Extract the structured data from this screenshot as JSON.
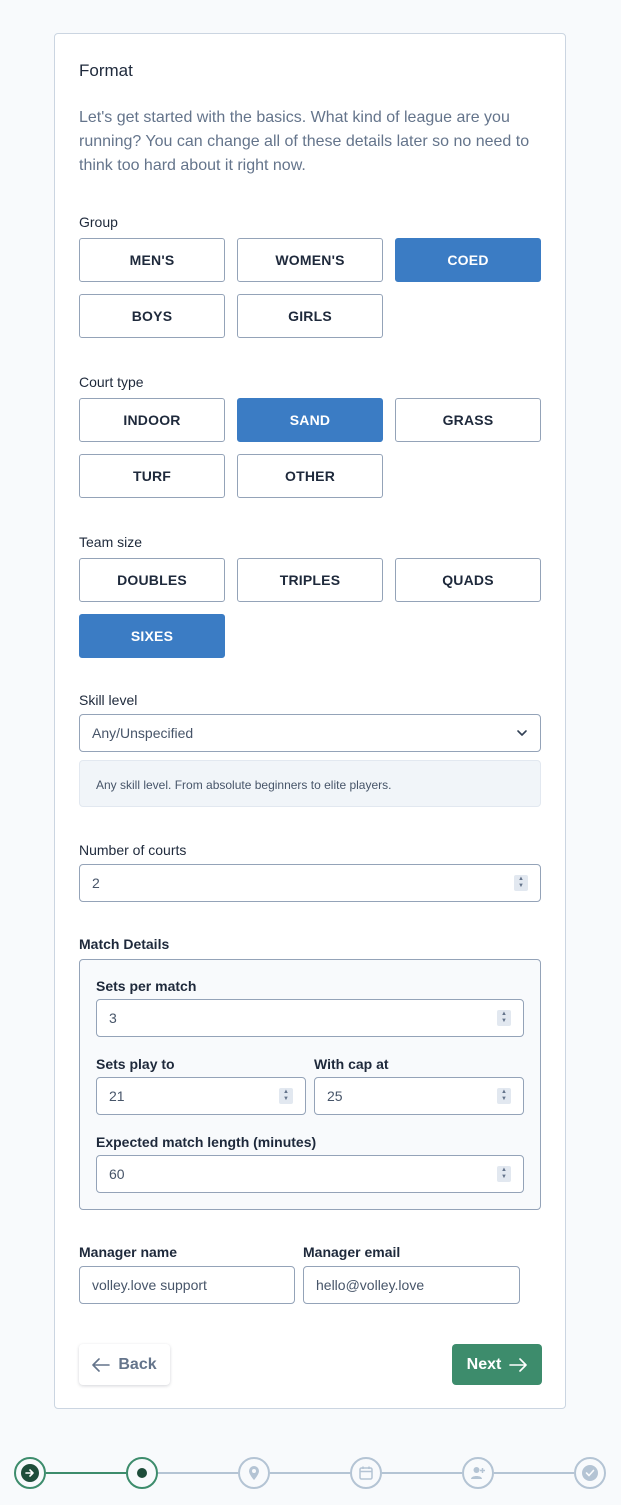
{
  "format": {
    "title": "Format",
    "intro": "Let's get started with the basics. What kind of league are you running? You can change all of these details later so no need to think too hard about it right now."
  },
  "group": {
    "label": "Group",
    "options": [
      "MEN'S",
      "WOMEN'S",
      "COED",
      "BOYS",
      "GIRLS"
    ],
    "selected": "COED"
  },
  "court_type": {
    "label": "Court type",
    "options": [
      "INDOOR",
      "SAND",
      "GRASS",
      "TURF",
      "OTHER"
    ],
    "selected": "SAND"
  },
  "team_size": {
    "label": "Team size",
    "options": [
      "DOUBLES",
      "TRIPLES",
      "QUADS",
      "SIXES"
    ],
    "selected": "SIXES"
  },
  "skill_level": {
    "label": "Skill level",
    "value": "Any/Unspecified",
    "description": "Any skill level. From absolute beginners to elite players."
  },
  "courts": {
    "label": "Number of courts",
    "value": "2"
  },
  "match_details": {
    "label": "Match Details",
    "sets_per_match_label": "Sets per match",
    "sets_per_match": "3",
    "sets_play_to_label": "Sets play to",
    "sets_play_to": "21",
    "cap_label": "With cap at",
    "cap": "25",
    "length_label": "Expected match length (minutes)",
    "length": "60"
  },
  "manager": {
    "name_label": "Manager name",
    "name": "volley.love support",
    "email_label": "Manager email",
    "email": "hello@volley.love"
  },
  "nav": {
    "back": "Back",
    "next": "Next"
  },
  "colors": {
    "selected": "#3b7cc4",
    "primary": "#3d8c6c",
    "step_inactive": "#b4c4d4"
  },
  "stepper": {
    "steps": [
      "arrow-right-icon",
      "dot-icon",
      "location-pin-icon",
      "calendar-icon",
      "add-user-icon",
      "check-icon"
    ],
    "current": 1
  }
}
